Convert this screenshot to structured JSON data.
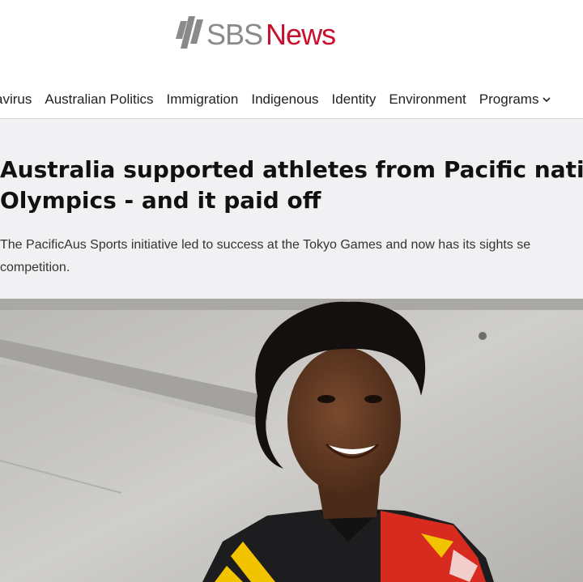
{
  "header": {
    "logo_sbs": "SBS",
    "logo_news": "News",
    "brand_color": "#c8102e"
  },
  "nav": {
    "items": [
      {
        "label": "avirus"
      },
      {
        "label": "Australian Politics"
      },
      {
        "label": "Immigration"
      },
      {
        "label": "Indigenous"
      },
      {
        "label": "Identity"
      },
      {
        "label": "Environment"
      },
      {
        "label": "Programs",
        "icon": "chevron-down-icon"
      }
    ]
  },
  "article": {
    "headline_line1": "Australia supported athletes from Pacific nations",
    "headline_line2": "Olympics - and it paid off",
    "standfirst_line1": "The PacificAus Sports initiative led to success at the Tokyo Games and now has its sights se",
    "standfirst_line2": "competition."
  },
  "photo": {
    "subject": "athlete-portrait"
  }
}
